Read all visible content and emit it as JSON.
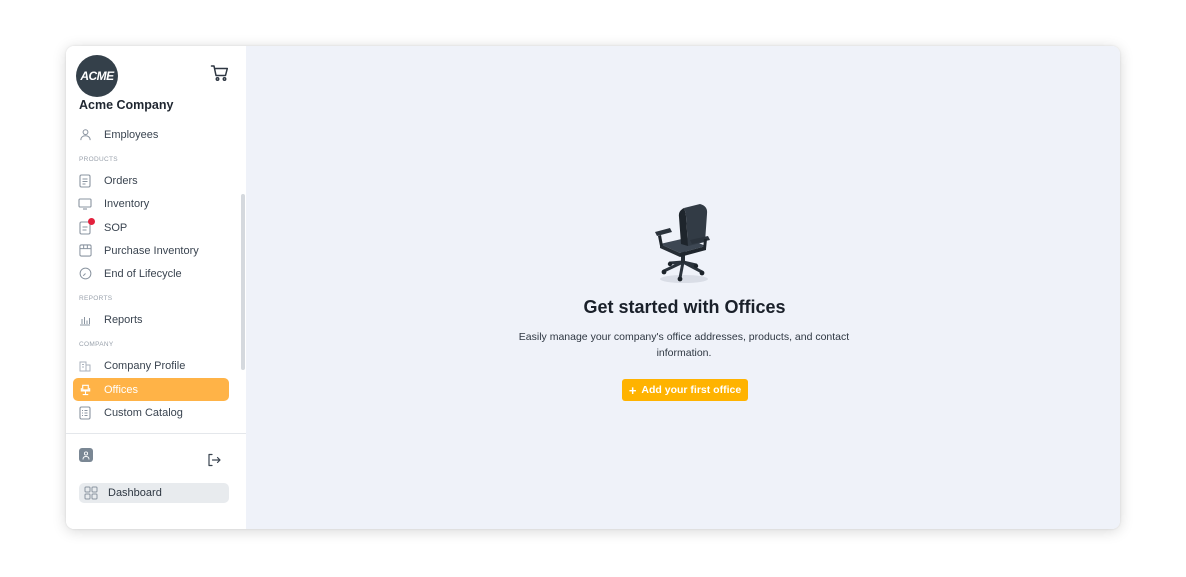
{
  "company": {
    "logo_text": "ACME",
    "name": "Acme Company"
  },
  "sidebar": {
    "top_items": [
      {
        "label": "Employees",
        "icon": "user-icon"
      }
    ],
    "sections": [
      {
        "label": "PRODUCTS",
        "items": [
          {
            "label": "Orders",
            "icon": "document-icon"
          },
          {
            "label": "Inventory",
            "icon": "monitor-icon"
          },
          {
            "label": "SOP",
            "icon": "sop-icon",
            "notification": true
          },
          {
            "label": "Purchase Inventory",
            "icon": "box-icon"
          },
          {
            "label": "End of Lifecycle",
            "icon": "clock-icon"
          }
        ]
      },
      {
        "label": "REPORTS",
        "items": [
          {
            "label": "Reports",
            "icon": "bar-chart-icon"
          }
        ]
      },
      {
        "label": "COMPANY",
        "items": [
          {
            "label": "Company Profile",
            "icon": "building-icon"
          },
          {
            "label": "Offices",
            "icon": "chair-icon",
            "active": true
          },
          {
            "label": "Custom Catalog",
            "icon": "catalog-icon"
          }
        ]
      }
    ],
    "dashboard_label": "Dashboard"
  },
  "main": {
    "empty_state": {
      "title": "Get started with Offices",
      "description": "Easily manage your company's office addresses, products, and contact information.",
      "button_label": "Add your first office"
    }
  },
  "colors": {
    "accent": "#ffb300",
    "active_nav": "#ffb347",
    "main_bg": "#eff2f9",
    "notification": "#e3213d"
  }
}
